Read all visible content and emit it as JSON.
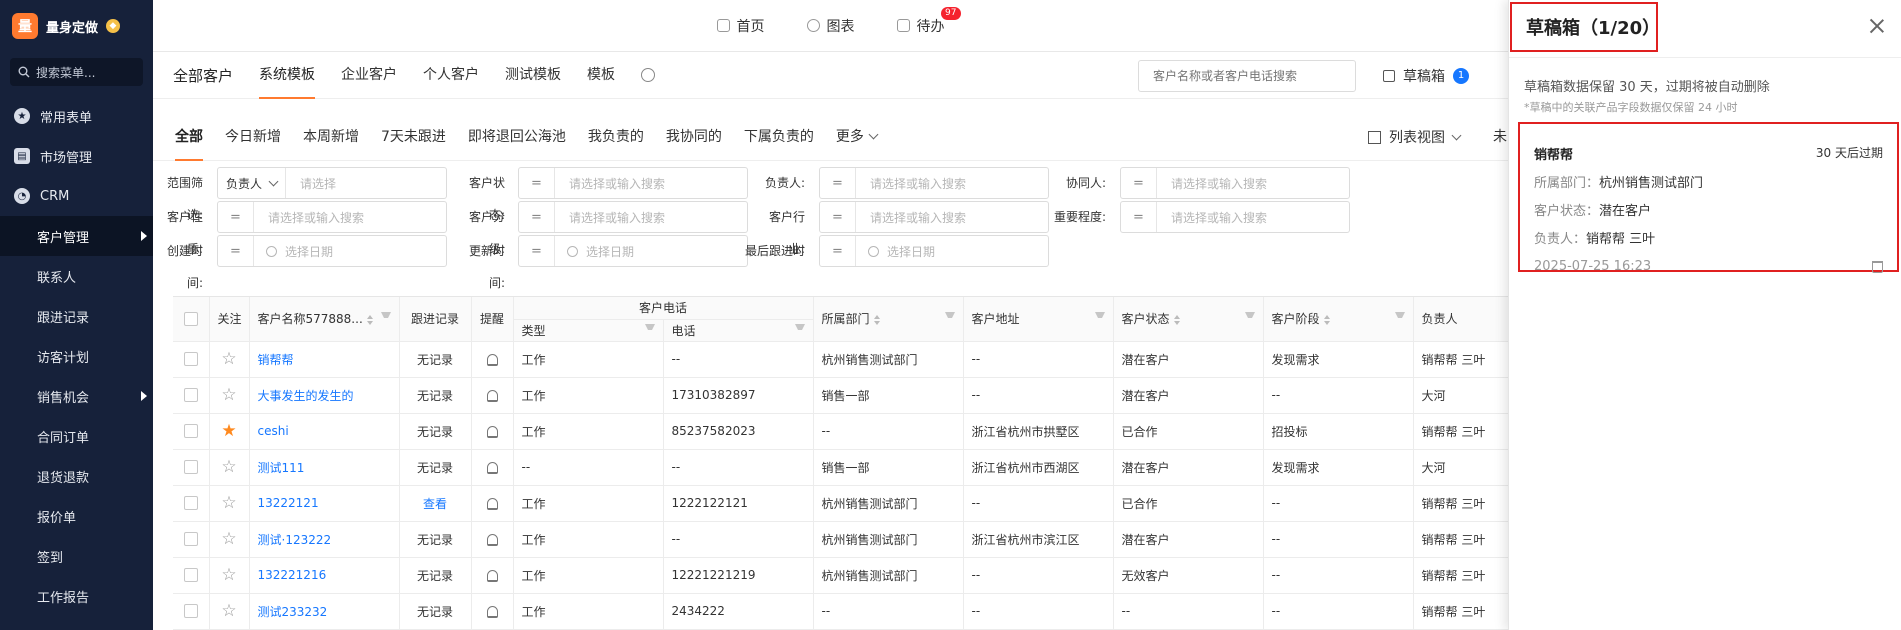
{
  "sidebar": {
    "brand_logo": "量",
    "brand_name": "量身定做",
    "brand_badge_icon": "diamond-icon",
    "search_placeholder": "搜索菜单...",
    "menu": [
      {
        "label": "常用表单",
        "icon": "star-icon"
      },
      {
        "label": "市场管理",
        "icon": "clipboard-icon"
      },
      {
        "label": "CRM",
        "icon": "pie-chart-icon"
      }
    ],
    "submenu": [
      {
        "label": "客户管理",
        "active": true,
        "arrow": true
      },
      {
        "label": "联系人"
      },
      {
        "label": "跟进记录"
      },
      {
        "label": "访客计划"
      },
      {
        "label": "销售机会",
        "arrow": true
      },
      {
        "label": "合同订单"
      },
      {
        "label": "退货退款"
      },
      {
        "label": "报价单"
      },
      {
        "label": "签到"
      },
      {
        "label": "工作报告"
      }
    ]
  },
  "topbar": {
    "home": "首页",
    "charts": "图表",
    "todo": "待办",
    "todo_badge": "97"
  },
  "view_tabs": {
    "title": "全部客户",
    "tabs": [
      "系统模板",
      "企业客户",
      "个人客户",
      "测试模板",
      "模板"
    ],
    "active": "系统模板",
    "search_placeholder": "客户名称或者客户电话搜索",
    "drafts_label": "草稿箱",
    "drafts_count": "1"
  },
  "filter_tabs": {
    "tabs": [
      "全部",
      "今日新增",
      "本周新增",
      "7天未跟进",
      "即将退回公海池",
      "我负责的",
      "我协同的",
      "下属负责的"
    ],
    "more": "更多",
    "list_view": "列表视图",
    "list_view_next": "未"
  },
  "filters": {
    "range_label": "范围筛选:",
    "range_select": "负责人",
    "range_placeholder": "请选择",
    "status_label": "客户状态:",
    "owner_label": "负责人:",
    "collab_label": "协同人:",
    "nature_label": "客户性质:",
    "level_label": "客户分级:",
    "industry_label": "客户行业:",
    "importance_label": "重要程度:",
    "created_label": "创建时间:",
    "updated_label": "更新时间:",
    "lastfollow_label": "最后跟进时",
    "select_placeholder": "请选择或输入搜索",
    "date_placeholder": "选择日期",
    "eq_symbol": "="
  },
  "table": {
    "headers": {
      "follow": "关注",
      "name": "客户名称577888...",
      "record": "跟进记录",
      "remind": "提醒",
      "phone_group": "客户电话",
      "type": "类型",
      "phone": "电话",
      "dept": "所属部门",
      "address": "客户地址",
      "status": "客户状态",
      "stage": "客户阶段",
      "owner": "负责人"
    },
    "rows": [
      {
        "starred": false,
        "name": "销帮帮",
        "record": "无记录",
        "record_link": false,
        "type": "工作",
        "phone": "--",
        "dept": "杭州销售测试部门",
        "address": "--",
        "status": "潜在客户",
        "stage": "发现需求",
        "owner": "销帮帮 三叶"
      },
      {
        "starred": false,
        "name": "大事发生的发生的",
        "record": "无记录",
        "record_link": false,
        "type": "工作",
        "phone": "17310382897",
        "dept": "销售一部",
        "address": "--",
        "status": "潜在客户",
        "stage": "--",
        "owner": "大河"
      },
      {
        "starred": true,
        "name": "ceshi",
        "record": "无记录",
        "record_link": false,
        "type": "工作",
        "phone": "85237582023",
        "dept": "--",
        "address": "浙江省杭州市拱墅区",
        "status": "已合作",
        "stage": "招投标",
        "owner": "销帮帮 三叶"
      },
      {
        "starred": false,
        "name": "测试111",
        "record": "无记录",
        "record_link": false,
        "type": "--",
        "phone": "--",
        "dept": "销售一部",
        "address": "浙江省杭州市西湖区",
        "status": "潜在客户",
        "stage": "发现需求",
        "owner": "大河"
      },
      {
        "starred": false,
        "name": "13222121",
        "record": "查看",
        "record_link": true,
        "type": "工作",
        "phone": "1222122121",
        "dept": "杭州销售测试部门",
        "address": "--",
        "status": "已合作",
        "stage": "--",
        "owner": "销帮帮 三叶"
      },
      {
        "starred": false,
        "name": "测试·123222",
        "record": "无记录",
        "record_link": false,
        "type": "工作",
        "phone": "--",
        "dept": "杭州销售测试部门",
        "address": "浙江省杭州市滨江区",
        "status": "潜在客户",
        "stage": "--",
        "owner": "销帮帮 三叶"
      },
      {
        "starred": false,
        "name": "132221216",
        "record": "无记录",
        "record_link": false,
        "type": "工作",
        "phone": "12221221219",
        "dept": "杭州销售测试部门",
        "address": "--",
        "status": "无效客户",
        "stage": "--",
        "owner": "销帮帮 三叶"
      },
      {
        "starred": false,
        "name": "测试233232",
        "record": "无记录",
        "record_link": false,
        "type": "工作",
        "phone": "2434222",
        "dept": "--",
        "address": "--",
        "status": "--",
        "stage": "--",
        "owner": "销帮帮 三叶"
      }
    ]
  },
  "drawer": {
    "title": "草稿箱（1/20）",
    "note": "草稿箱数据保留 30 天，过期将被自动删除",
    "sub_note": "*草稿中的关联产品字段数据仅保留 24 小时",
    "card": {
      "name": "销帮帮",
      "expire": "30 天后过期",
      "dept_key": "所属部门：",
      "dept_val": "杭州销售测试部门",
      "status_key": "客户状态：",
      "status_val": "潜在客户",
      "owner_key": "负责人：",
      "owner_val": "销帮帮 三叶",
      "time": "2025-07-25 16:23"
    }
  },
  "colors": {
    "sidebar_bg": "#16213a",
    "accent": "#ff7a2f",
    "link": "#1677ff",
    "highlight_border": "#e02020",
    "badge_red": "#f5222d"
  }
}
